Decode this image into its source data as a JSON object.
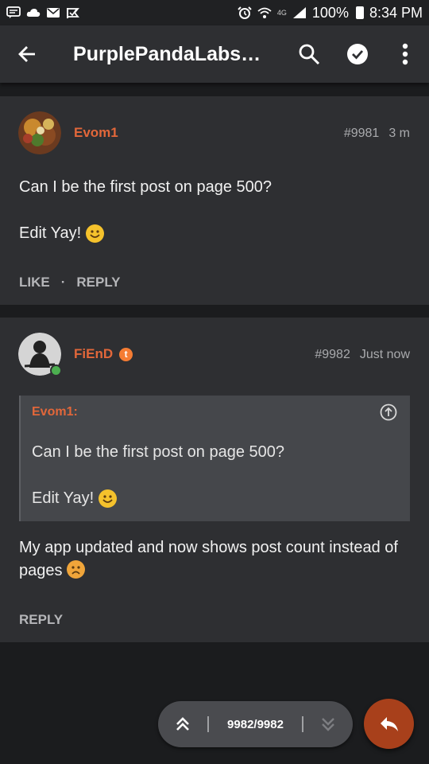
{
  "status_bar": {
    "battery": "100%",
    "time": "8:34 PM",
    "network": "4G",
    "icons": [
      "chat-icon",
      "cloud-icon",
      "mail-icon",
      "check-flag-icon",
      "alarm-icon",
      "wifi-icon",
      "signal-icon",
      "battery-icon"
    ]
  },
  "app_bar": {
    "title": "PurplePandaLabs…",
    "icons": [
      "back-arrow-icon",
      "search-icon",
      "check-circle-icon",
      "more-vert-icon"
    ]
  },
  "posts": [
    {
      "author": "Evom1",
      "post_number": "#9981",
      "time": "3 m",
      "body_line1": "Can I be the first post on page 500?",
      "body_line2": "Edit Yay!",
      "emoji": "smile",
      "like_label": "LIKE",
      "separator": "·",
      "reply_label": "REPLY"
    },
    {
      "author": "FiEnD",
      "badge": "t",
      "post_number": "#9982",
      "time": "Just now",
      "quote": {
        "author": "Evom1:",
        "line1": "Can I be the first post on page 500?",
        "line2": "Edit Yay!"
      },
      "body": "My app updated and now shows post count instead of pages",
      "emoji": "sad",
      "reply_label": "REPLY"
    }
  ],
  "pager": {
    "count": "9982/9982"
  },
  "colors": {
    "accent": "#e2673a",
    "card": "#2e2f32",
    "fab": "#a8401b",
    "online": "#4caf50"
  }
}
